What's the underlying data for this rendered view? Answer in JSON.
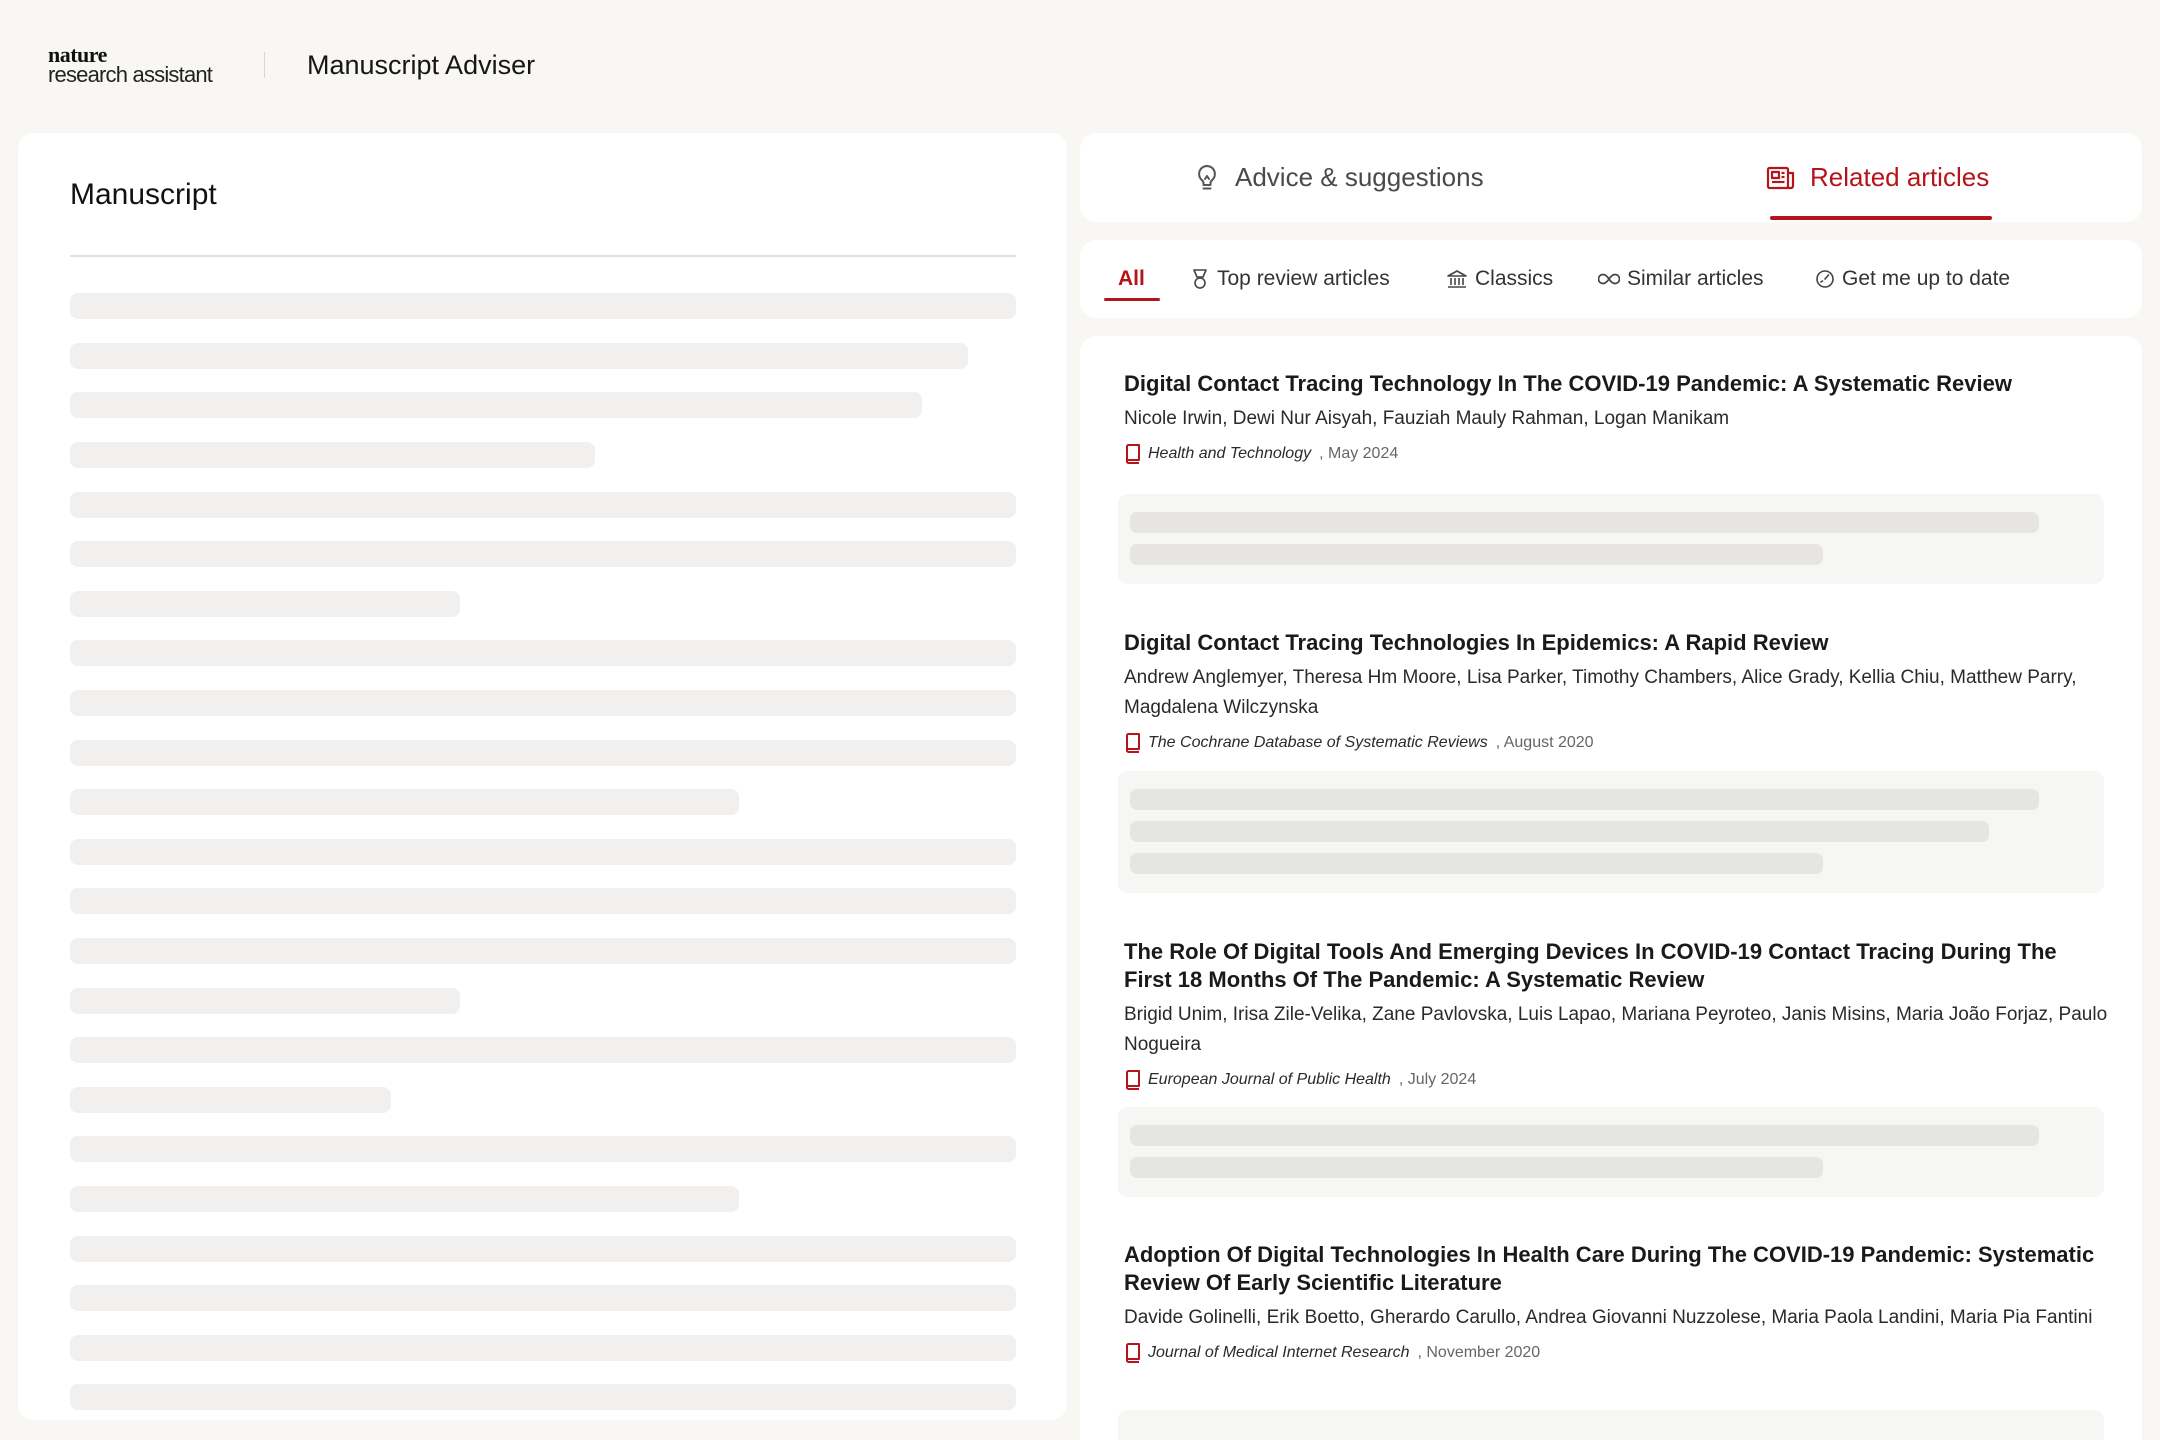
{
  "header": {
    "logo_line1": "nature",
    "logo_line2": "research assistant",
    "app_title": "Manuscript Adviser"
  },
  "manuscript": {
    "title": "Manuscript",
    "status": "loading"
  },
  "tabs": [
    {
      "label": "Advice & suggestions",
      "icon": "lightbulb-icon",
      "active": false
    },
    {
      "label": "Related articles",
      "icon": "newspaper-icon",
      "active": true
    }
  ],
  "filters": [
    {
      "label": "All",
      "icon": "",
      "active": true
    },
    {
      "label": "Top review articles",
      "icon": "medal-icon",
      "active": false
    },
    {
      "label": "Classics",
      "icon": "columns-building-icon",
      "active": false
    },
    {
      "label": "Similar articles",
      "icon": "infinity-icon",
      "active": false
    },
    {
      "label": "Get me up to date",
      "icon": "gauge-icon",
      "active": false
    }
  ],
  "articles": [
    {
      "title": "Digital Contact Tracing Technology In The COVID-19 Pandemic: A Systematic Review",
      "authors": "Nicole Irwin, Dewi Nur Aisyah, Fauziah Mauly Rahman, Logan Manikam",
      "journal": "Health and Technology",
      "date": ", May 2024"
    },
    {
      "title": "Digital Contact Tracing Technologies In Epidemics: A Rapid Review",
      "authors": "Andrew Anglemyer, Theresa Hm Moore, Lisa Parker, Timothy Chambers, Alice Grady, Kellia Chiu, Matthew Parry, Magdalena Wilczynska",
      "journal": "The Cochrane Database of Systematic Reviews",
      "date": ", August 2020"
    },
    {
      "title": "The Role Of Digital Tools And Emerging Devices In COVID-19 Contact Tracing During The First 18 Months Of The Pandemic: A Systematic Review",
      "authors": "Brigid Unim, Irisa Zile-Velika, Zane Pavlovska, Luis Lapao, Mariana Peyroteo, Janis Misins, Maria João Forjaz, Paulo Nogueira",
      "journal": "European Journal of Public Health",
      "date": ", July 2024"
    },
    {
      "title": "Adoption Of Digital Technologies In Health Care During The COVID-19 Pandemic: Systematic Review Of Early Scientific Literature",
      "authors": "Davide Golinelli, Erik Boetto, Gherardo Carullo, Andrea Giovanni Nuzzolese, Maria Paola Landini, Maria Pia Fantini",
      "journal": "Journal of Medical Internet Research",
      "date": ", November 2020"
    }
  ],
  "colors": {
    "accent": "#b5141b",
    "background": "#f8f7f4",
    "card": "#ffffff",
    "skeleton": "#f1f0ee"
  }
}
